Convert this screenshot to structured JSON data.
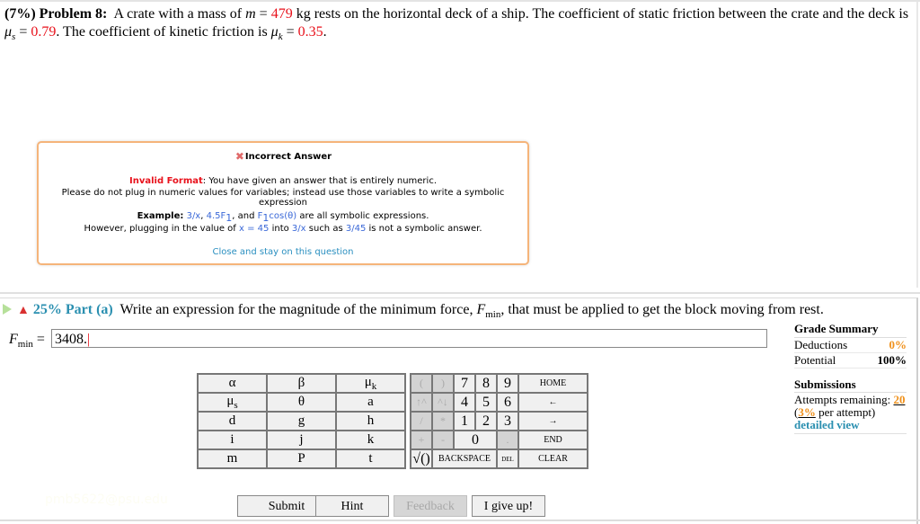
{
  "problem": {
    "percent": "(7%)",
    "label": "Problem 8:",
    "text_a": "A crate with a mass of",
    "m_symbol": "m",
    "m_value": "479",
    "m_unit": "kg rests on the horizontal deck of a ship. The coefficient of static friction between the crate and the deck is",
    "mus_symbol": "μ",
    "mus_sub": "s",
    "mus_value": "0.79",
    "text_b": ". The coefficient of kinetic friction is",
    "muk_symbol": "μ",
    "muk_sub": "k",
    "muk_value": "0.35",
    "equals": "=",
    "period": "."
  },
  "modal": {
    "title": "Incorrect Answer",
    "invalid_label": "Invalid Format",
    "line1_rest": ": You have given an answer that is entirely numeric.",
    "line2": "Please do not plug in numeric values for variables; instead use those variables to write a symbolic expression",
    "example_label": "Example:",
    "ex1": "3/x",
    "ex2": "4.5F",
    "ex2_sub": "1",
    "and": ", and",
    "ex3": "F",
    "ex3_sub": "1",
    "ex3_rest": "cos(θ)",
    "example_tail": "are all symbolic expressions.",
    "line4_a": "However, plugging in the value of",
    "line4_x": "x = 45",
    "line4_b": "into",
    "line4_expr": "3/x",
    "line4_c": "such as",
    "line4_val": "3/45",
    "line4_d": "is not a symbolic answer.",
    "close_link": "Close and stay on this question"
  },
  "part": {
    "percent": "25%",
    "label": "Part (a)",
    "text_a": "Write an expression for the magnitude of the minimum force,",
    "F": "F",
    "F_sub": "min",
    "text_b": ", that must be applied to get the block moving from rest."
  },
  "answer": {
    "label_F": "F",
    "label_sub": "min",
    "equals": "=",
    "value": "3408.",
    "caret": "|"
  },
  "grade_summary": {
    "title": "Grade Summary",
    "deductions_label": "Deductions",
    "deductions_value": "0%",
    "potential_label": "Potential",
    "potential_value": "100%"
  },
  "submissions": {
    "title": "Submissions",
    "attempts_label": "Attempts remaining:",
    "attempts_value": "20",
    "per_open": "(",
    "per_value": "3%",
    "per_text": "per attempt)",
    "detailed_link": "detailed view"
  },
  "keyboard": {
    "variables": [
      [
        "α",
        "β",
        "μk"
      ],
      [
        "μs",
        "θ",
        "a"
      ],
      [
        "d",
        "g",
        "h"
      ],
      [
        "i",
        "j",
        "k"
      ],
      [
        "m",
        "P",
        "t"
      ]
    ],
    "pad": {
      "open_paren": "(",
      "close_paren": ")",
      "up": "↑^",
      "down": "^↓",
      "divide": "/",
      "multiply": "*",
      "plus": "+",
      "minus": "-",
      "sqrt": "√()",
      "d7": "7",
      "d8": "8",
      "d9": "9",
      "d4": "4",
      "d5": "5",
      "d6": "6",
      "d1": "1",
      "d2": "2",
      "d3": "3",
      "d0": "0",
      "dot": ".",
      "home": "HOME",
      "left": "←",
      "right": "→",
      "end": "END",
      "backspace": "BACKSPACE",
      "del": "DEL",
      "clear": "CLEAR"
    }
  },
  "buttons": {
    "submit": "Submit",
    "hint": "Hint",
    "feedback": "Feedback",
    "give_up": "I give up!"
  },
  "watermark": "pmb5622@psu.edu"
}
